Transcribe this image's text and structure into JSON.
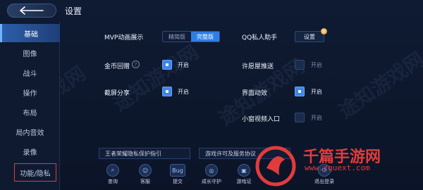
{
  "header": {
    "title": "设置"
  },
  "sidebar": {
    "items": [
      {
        "label": "基础"
      },
      {
        "label": "图像"
      },
      {
        "label": "战斗"
      },
      {
        "label": "操作"
      },
      {
        "label": "布局"
      },
      {
        "label": "局内音效"
      },
      {
        "label": "录像"
      },
      {
        "label": "功能/隐私"
      }
    ],
    "active_index": 0,
    "boxed_index": 7
  },
  "settings": {
    "mvp": {
      "label": "MVP动画展示",
      "options": [
        "精简版",
        "完整版"
      ],
      "selected": "完整版"
    },
    "qq_assistant": {
      "label": "QQ私人助手",
      "button": "设置",
      "badge": "新"
    },
    "gold_replay": {
      "label": "金币回赠",
      "state": "开启",
      "checked": true
    },
    "allow_push": {
      "label": "许愿屋推送",
      "state": "开启",
      "checked": false
    },
    "screenshot_share": {
      "label": "截屏分享",
      "state": "开启",
      "checked": true
    },
    "ui_animation": {
      "label": "界面动效",
      "state": "开启",
      "checked": true
    },
    "small_window": {
      "label": "小窗视频入口",
      "state": "开启",
      "checked": false
    }
  },
  "links": {
    "privacy_guide": "王者荣耀隐私保护指引",
    "game_license": "游戏许可及服务协议"
  },
  "bottom": [
    {
      "label": "查询",
      "icon": "search-icon"
    },
    {
      "label": "客服",
      "icon": "service-icon"
    },
    {
      "label": "提交",
      "icon": "bug-icon",
      "glyph": "Bug"
    },
    {
      "label": "成长守护",
      "icon": "guard-icon"
    },
    {
      "label": "游戏证",
      "icon": "license-icon"
    },
    {
      "label": "退出登录",
      "icon": "logout-icon"
    }
  ],
  "watermark": {
    "diag": "途知游戏网",
    "brand": "千篇手游网",
    "url": "www.zquext.com"
  },
  "colors": {
    "accent": "#2f7ee6",
    "active_tab": "#2c5da8",
    "highlight_box": "#e33a3a",
    "watermark": "#e23b3b"
  }
}
